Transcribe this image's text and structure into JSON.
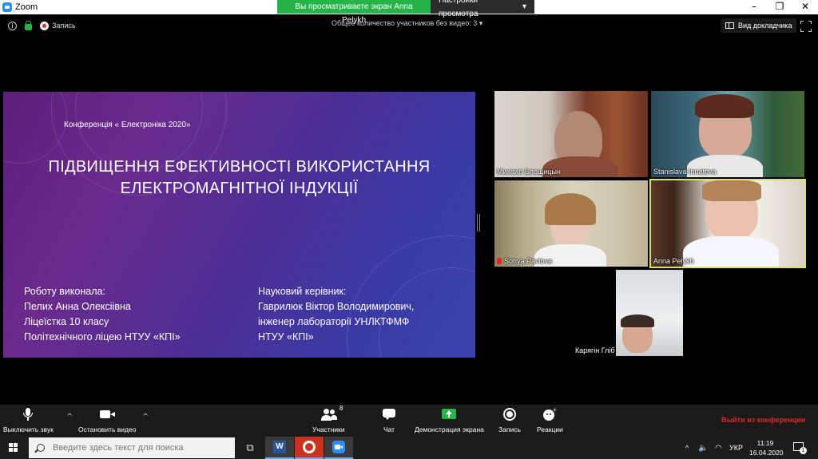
{
  "window": {
    "app_title": "Zoom",
    "controls": [
      "–",
      "❐",
      "✕"
    ]
  },
  "share_banner": {
    "viewing_text": "Вы просматриваете экран Anna Pelykh",
    "view_options_label": "Настройки просмотра",
    "view_options_caret": "▾"
  },
  "info_bar": {
    "info_icon": "i",
    "recording_label": "Запись",
    "participants_without_video": "Общее количество участников без видео: 3  ▾",
    "speaker_view_label": "Вид докладчика"
  },
  "slide": {
    "conference": "Конференція « Електроніка 2020»",
    "title_line1": "ПІДВИЩЕННЯ ЕФЕКТИВНОСТІ ВИКОРИСТАННЯ",
    "title_line2": "ЕЛЕКТРОМАГНІТНОЇ ІНДУКЦІЇ",
    "author": [
      "Роботу виконала:",
      "Пелих Анна Олексіівна",
      "Ліцеїстка 10 класу",
      "Політехнічного ліцею НТУУ «КПІ»"
    ],
    "advisor": [
      "Науковий керівник:",
      "Гаврилюк  Віктор Володимирович,",
      "інженер лабораторії  УНЛКТФМФ",
      "НТУУ «КПІ»"
    ]
  },
  "participants": [
    {
      "name": "Михаил Блощицын",
      "muted": false
    },
    {
      "name": "Stanislava Innatova",
      "muted": false
    },
    {
      "name": "Sonya Pavlova",
      "muted": true
    },
    {
      "name": "Anna Pelykh",
      "muted": false,
      "active_speaker": true
    },
    {
      "name": "Карягін Гліб",
      "muted": false
    }
  ],
  "toolbar": {
    "mute": "Выключить звук",
    "stop_video": "Остановить видео",
    "participants": "Участники",
    "participants_count": "8",
    "chat": "Чат",
    "share_screen": "Демонстрация экрана",
    "record": "Запись",
    "reactions": "Реакции",
    "leave": "Выйти из конференции",
    "caret": "^"
  },
  "taskbar": {
    "search_placeholder": "Введите здесь текст для поиска",
    "tray_caret": "^",
    "language": "УКР",
    "time": "11:19",
    "date": "16.04.2020",
    "notifications_count": "1",
    "task_view_icon": "⧉"
  },
  "colors": {
    "share_green": "#26b34a",
    "leave_red": "#e02828",
    "active_speaker_border": "#d7e65a",
    "toolbar_bg": "#1a1a1a"
  }
}
